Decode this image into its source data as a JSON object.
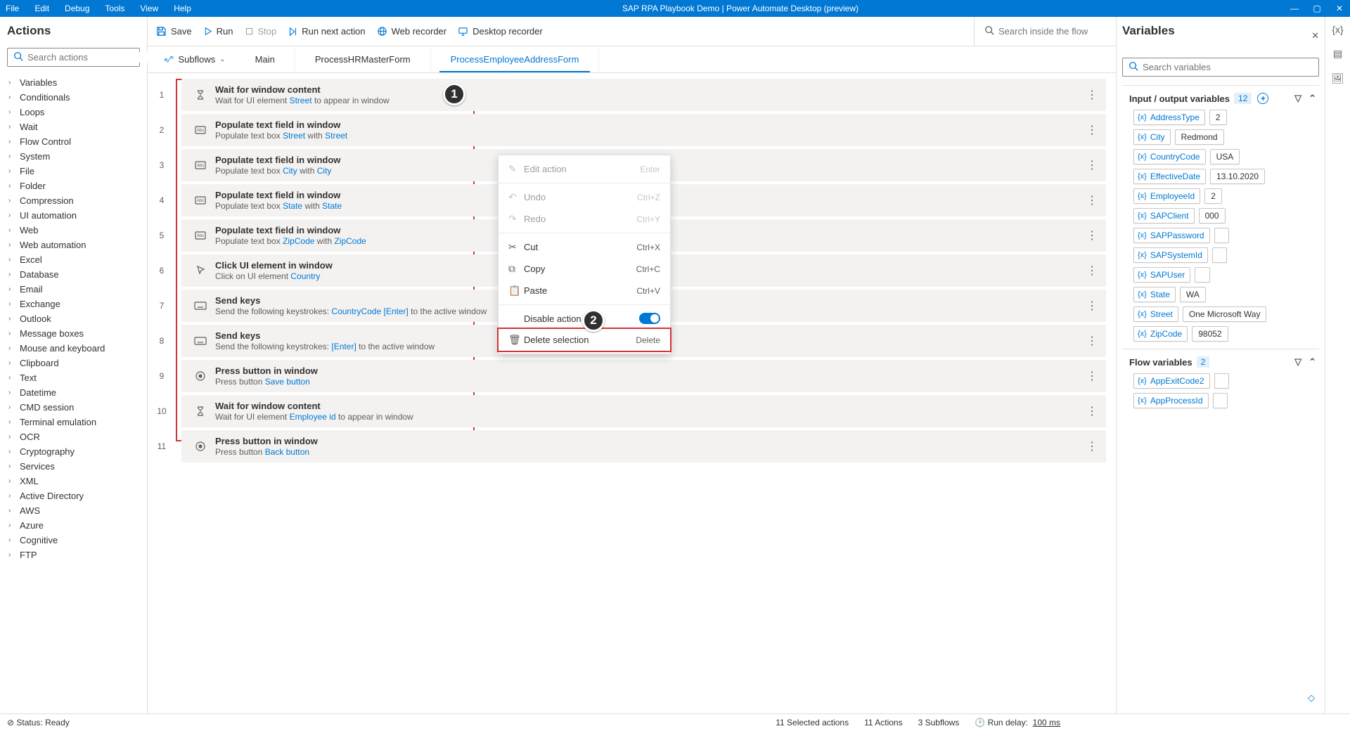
{
  "titlebar": {
    "menu": [
      "File",
      "Edit",
      "Debug",
      "Tools",
      "View",
      "Help"
    ],
    "title": "SAP RPA Playbook Demo | Power Automate Desktop (preview)"
  },
  "actions": {
    "title": "Actions",
    "search_placeholder": "Search actions",
    "tree": [
      "Variables",
      "Conditionals",
      "Loops",
      "Wait",
      "Flow Control",
      "System",
      "File",
      "Folder",
      "Compression",
      "UI automation",
      "Web",
      "Web automation",
      "Excel",
      "Database",
      "Email",
      "Exchange",
      "Outlook",
      "Message boxes",
      "Mouse and keyboard",
      "Clipboard",
      "Text",
      "Datetime",
      "CMD session",
      "Terminal emulation",
      "OCR",
      "Cryptography",
      "Services",
      "XML",
      "Active Directory",
      "AWS",
      "Azure",
      "Cognitive",
      "FTP"
    ]
  },
  "toolbar": {
    "save": "Save",
    "run": "Run",
    "stop": "Stop",
    "run_next": "Run next action",
    "web_rec": "Web recorder",
    "desk_rec": "Desktop recorder",
    "search_placeholder": "Search inside the flow"
  },
  "tabs": {
    "subflows": "Subflows",
    "items": [
      "Main",
      "ProcessHRMasterForm",
      "ProcessEmployeeAddressForm"
    ],
    "active": 2
  },
  "steps": [
    {
      "n": "1",
      "icon": "hourglass",
      "title": "Wait for window content",
      "desc_parts": [
        "Wait for UI element ",
        {
          "l": "Street"
        },
        " to appear in window"
      ]
    },
    {
      "n": "2",
      "icon": "textbox",
      "title": "Populate text field in window",
      "desc_parts": [
        "Populate text box ",
        {
          "l": "Street"
        },
        " with   ",
        {
          "l": "Street"
        }
      ]
    },
    {
      "n": "3",
      "icon": "textbox",
      "title": "Populate text field in window",
      "desc_parts": [
        "Populate text box ",
        {
          "l": "City"
        },
        " with   ",
        {
          "l": "City"
        }
      ]
    },
    {
      "n": "4",
      "icon": "textbox",
      "title": "Populate text field in window",
      "desc_parts": [
        "Populate text box ",
        {
          "l": "State"
        },
        " with   ",
        {
          "l": "State"
        }
      ]
    },
    {
      "n": "5",
      "icon": "textbox",
      "title": "Populate text field in window",
      "desc_parts": [
        "Populate text box ",
        {
          "l": "ZipCode"
        },
        " with   ",
        {
          "l": "ZipCode"
        }
      ]
    },
    {
      "n": "6",
      "icon": "cursor",
      "title": "Click UI element in window",
      "desc_parts": [
        "Click on UI element ",
        {
          "l": "Country"
        }
      ]
    },
    {
      "n": "7",
      "icon": "keyboard",
      "title": "Send keys",
      "desc_parts": [
        "Send the following keystrokes:   ",
        {
          "l": "CountryCode"
        },
        "  ",
        {
          "l": "[Enter]"
        },
        " to the active window"
      ]
    },
    {
      "n": "8",
      "icon": "keyboard",
      "title": "Send keys",
      "desc_parts": [
        "Send the following keystrokes: ",
        {
          "l": "[Enter]"
        },
        " to the active window"
      ]
    },
    {
      "n": "9",
      "icon": "button",
      "title": "Press button in window",
      "desc_parts": [
        "Press button ",
        {
          "l": "Save button"
        }
      ]
    },
    {
      "n": "10",
      "icon": "hourglass",
      "title": "Wait for window content",
      "desc_parts": [
        "Wait for UI element ",
        {
          "l": "Employee id"
        },
        " to appear in window"
      ]
    },
    {
      "n": "11",
      "icon": "button",
      "title": "Press button in window",
      "desc_parts": [
        "Press button ",
        {
          "l": "Back button"
        }
      ]
    }
  ],
  "ctx": {
    "edit": "Edit action",
    "edit_s": "Enter",
    "undo": "Undo",
    "undo_s": "Ctrl+Z",
    "redo": "Redo",
    "redo_s": "Ctrl+Y",
    "cut": "Cut",
    "cut_s": "Ctrl+X",
    "copy": "Copy",
    "copy_s": "Ctrl+C",
    "paste": "Paste",
    "paste_s": "Ctrl+V",
    "disable": "Disable action",
    "delete": "Delete selection",
    "delete_s": "Delete"
  },
  "vars": {
    "title": "Variables",
    "search_placeholder": "Search variables",
    "io_title": "Input / output variables",
    "io_count": "12",
    "io": [
      {
        "name": "AddressType",
        "val": "2"
      },
      {
        "name": "City",
        "val": "Redmond"
      },
      {
        "name": "CountryCode",
        "val": "USA"
      },
      {
        "name": "EffectiveDate",
        "val": "13.10.2020"
      },
      {
        "name": "EmployeeId",
        "val": "2"
      },
      {
        "name": "SAPClient",
        "val": "000"
      },
      {
        "name": "SAPPassword",
        "val": ""
      },
      {
        "name": "SAPSystemId",
        "val": ""
      },
      {
        "name": "SAPUser",
        "val": ""
      },
      {
        "name": "State",
        "val": "WA"
      },
      {
        "name": "Street",
        "val": "One Microsoft Way"
      },
      {
        "name": "ZipCode",
        "val": "98052"
      }
    ],
    "flow_title": "Flow variables",
    "flow_count": "2",
    "flow": [
      {
        "name": "AppExitCode2",
        "val": ""
      },
      {
        "name": "AppProcessId",
        "val": ""
      }
    ]
  },
  "status": {
    "ready": "Status: Ready",
    "selected": "11 Selected actions",
    "actions": "11 Actions",
    "subflows": "3 Subflows",
    "delay_label": "Run delay:",
    "delay_val": "100 ms"
  }
}
